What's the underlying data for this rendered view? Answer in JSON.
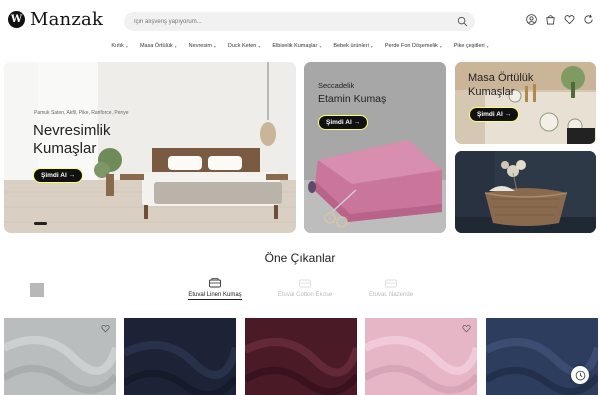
{
  "brand": {
    "logo_letter": "W",
    "name": "Manzak"
  },
  "search": {
    "placeholder": "İçin alışveriş yapıyorum..."
  },
  "header_icons": [
    "user-icon",
    "bag-icon",
    "heart-icon",
    "refresh-icon"
  ],
  "nav": [
    "Kırlık",
    "Masa Örtülük",
    "Nevresim",
    "Duck Keten",
    "Elbiselik Kumaşlar",
    "Bebek ürünleri",
    "Perde Fon Döşemelik",
    "Pike çeşitleri"
  ],
  "hero": {
    "main": {
      "subtitle": "Pamuk Saten, Akfil, Pike, Ranforce, Penye",
      "title_line1": "Nevresimlik",
      "title_line2": "Kumaşlar",
      "cta": "Şimdi Al →"
    },
    "second": {
      "subtitle": "Seccadelik",
      "title": "Etamin Kumaş",
      "cta": "Şimdi Al →"
    },
    "third": {
      "title_line1": "Masa Örtülük",
      "title_line2": "Kumaşlar",
      "cta": "Şimdi Al →"
    }
  },
  "section": {
    "title": "Öne Çıkanlar",
    "tabs": [
      {
        "label": "Etuval Linen Kumaş",
        "active": true
      },
      {
        "label": "Etuval Cotton Ekose",
        "active": false
      },
      {
        "label": "Etuval. Nazende",
        "active": false
      }
    ]
  },
  "products": [
    {
      "color": "#b8bcbd",
      "has_fav": true
    },
    {
      "color": "#1c2336",
      "has_fav": false
    },
    {
      "color": "#4a1a26",
      "has_fav": false
    },
    {
      "color": "#e6b6c7",
      "has_fav": true
    },
    {
      "color": "#2d3d5e",
      "has_fav": false
    }
  ],
  "colors": {
    "accent": "#fcff6b",
    "cta_bg": "#111111"
  }
}
